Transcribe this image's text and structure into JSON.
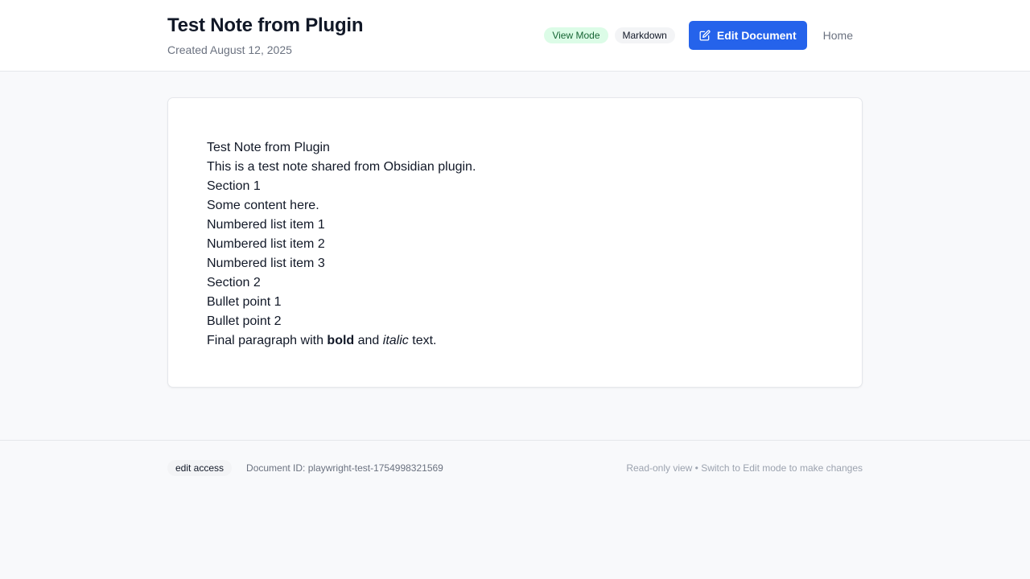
{
  "header": {
    "title": "Test Note from Plugin",
    "created": "Created August 12, 2025",
    "badges": {
      "mode": "View Mode",
      "format": "Markdown"
    },
    "edit_button": "Edit Document",
    "home_link": "Home"
  },
  "document": {
    "lines": [
      "Test Note from Plugin",
      "This is a test note shared from Obsidian plugin.",
      "Section 1",
      "Some content here.",
      "Numbered list item 1",
      "Numbered list item 2",
      "Numbered list item 3",
      "Section 2",
      "Bullet point 1",
      "Bullet point 2"
    ],
    "final": {
      "before": "Final paragraph with ",
      "bold": "bold",
      "middle": " and ",
      "italic": "italic",
      "after": " text."
    }
  },
  "footer": {
    "access": "edit access",
    "doc_id": "Document ID: playwright-test-1754998321569",
    "note": "Read-only view • Switch to Edit mode to make changes"
  },
  "colors": {
    "accent": "#2563eb",
    "view_badge_bg": "#dcfce7",
    "view_badge_text": "#166534",
    "page_bg": "#f8f9fb"
  },
  "icons": {
    "edit_button": "edit-square-icon"
  }
}
